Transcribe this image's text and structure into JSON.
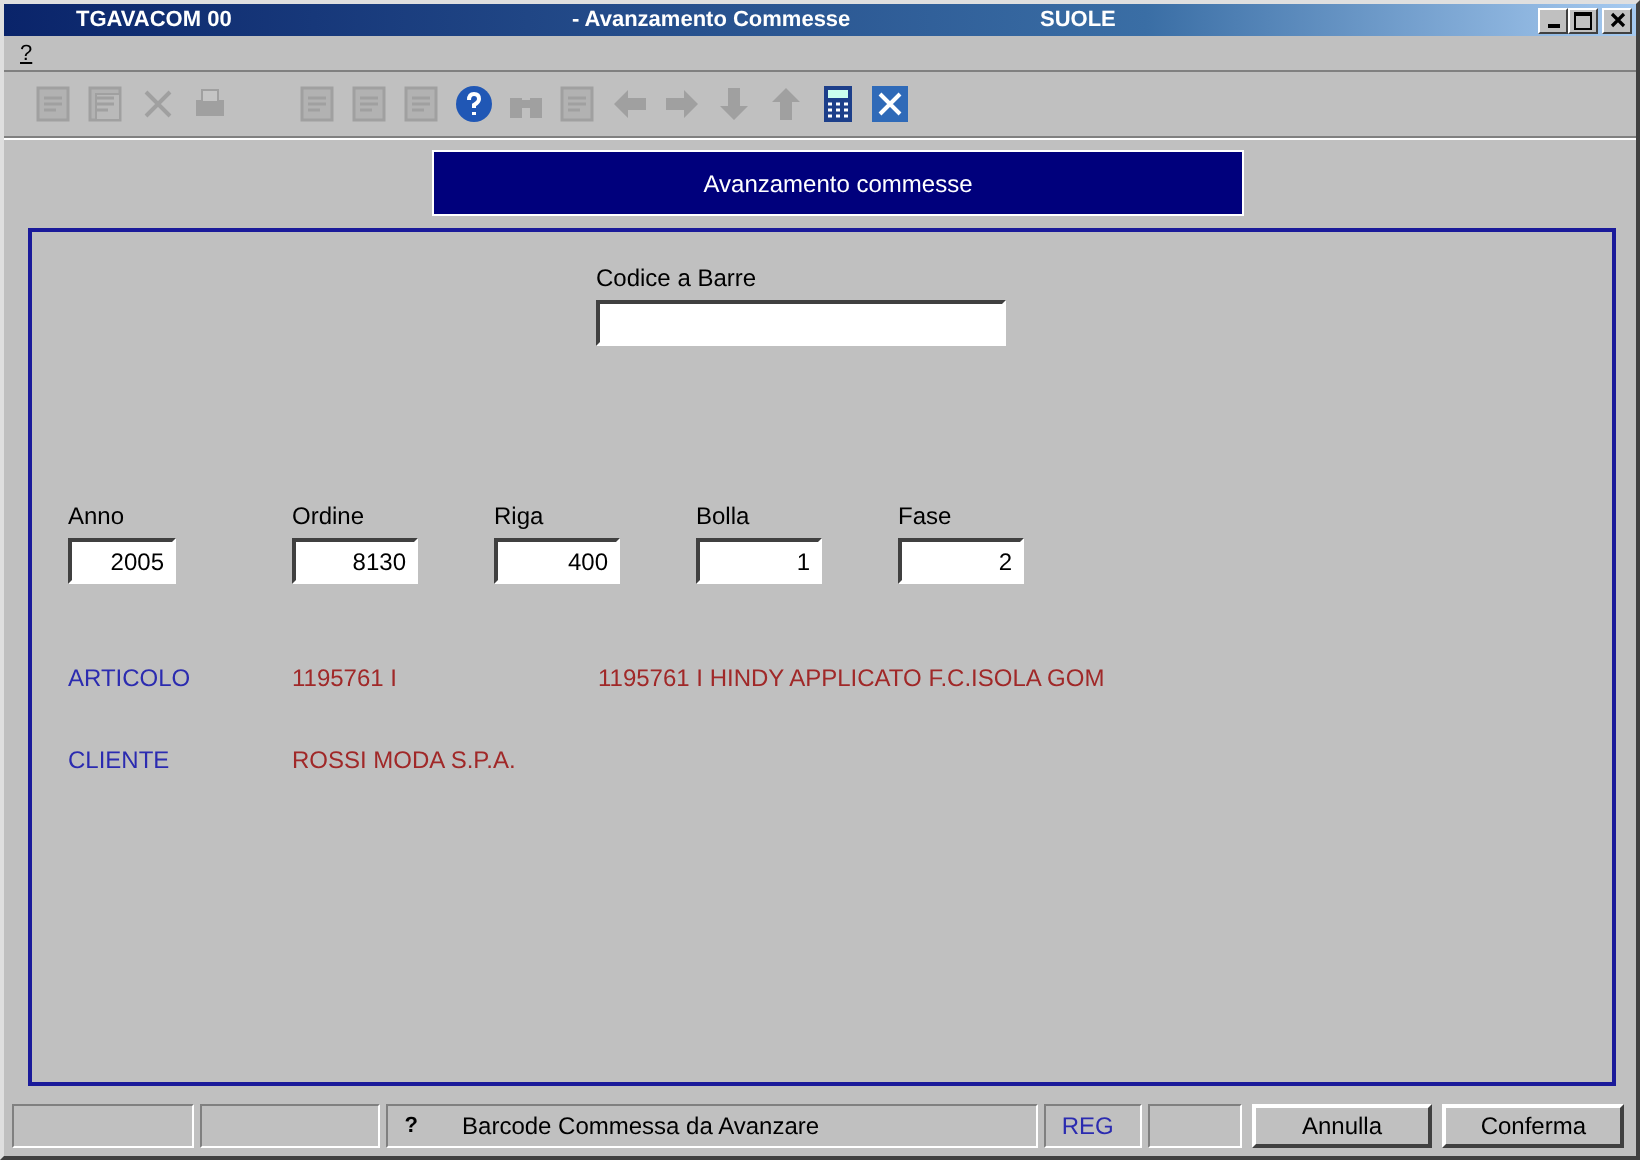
{
  "window": {
    "title_left": "TGAVACOM 00",
    "title": "- Avanzamento Commesse",
    "title_right": "SUOLE"
  },
  "menu": [
    {
      "label": "?"
    }
  ],
  "toolbar": [
    {
      "kind": "record",
      "disabled": true
    },
    {
      "kind": "copy",
      "disabled": true
    },
    {
      "kind": "delete",
      "disabled": true
    },
    {
      "kind": "print",
      "disabled": true
    },
    {
      "kind": "separator"
    },
    {
      "kind": "tree",
      "disabled": true
    },
    {
      "kind": "form",
      "disabled": true
    },
    {
      "kind": "edit",
      "disabled": true
    },
    {
      "kind": "help",
      "disabled": false
    },
    {
      "kind": "binoculars",
      "disabled": true
    },
    {
      "kind": "stamp",
      "disabled": true
    },
    {
      "kind": "left",
      "disabled": true
    },
    {
      "kind": "right",
      "disabled": true
    },
    {
      "kind": "down",
      "disabled": true
    },
    {
      "kind": "up",
      "disabled": true
    },
    {
      "kind": "calculator",
      "disabled": false
    },
    {
      "kind": "close",
      "disabled": false
    }
  ],
  "header": "Avanzamento commesse",
  "barcode": {
    "label": "Codice a Barre"
  },
  "fields": [
    {
      "label": "Anno",
      "value": "2005"
    },
    {
      "label": "Ordine",
      "value": "8130"
    },
    {
      "label": "Riga",
      "value": "400"
    },
    {
      "label": "Bolla",
      "value": "1"
    },
    {
      "label": "Fase",
      "value": "2"
    }
  ],
  "info": [
    {
      "label": "ARTICOLO",
      "code": "1195761 I",
      "description": "1195761 I HINDY APPLICATO F.C.ISOLA  GOM"
    },
    {
      "label": "CLIENTE",
      "code": "ROSSI MODA S.P.A."
    }
  ],
  "status_bar": {
    "help_mark": "?",
    "message": "Barcode Commessa da Avanzare",
    "mode": "REG"
  },
  "buttons": [
    "Annulla",
    "Conferma"
  ]
}
